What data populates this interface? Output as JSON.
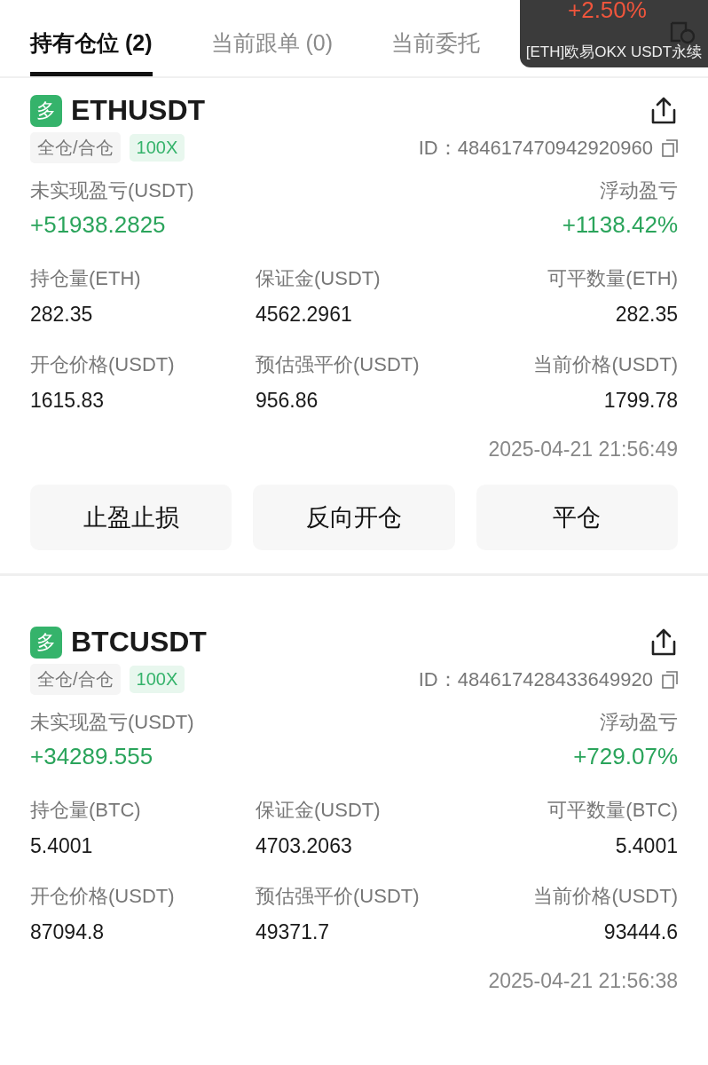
{
  "tabs": [
    {
      "label": "持有仓位 (2)",
      "selected": true
    },
    {
      "label": "当前跟单 (0)",
      "selected": false
    },
    {
      "label": "当前委托",
      "selected": false
    }
  ],
  "floating_widget": {
    "change": "+2.50%",
    "title": "[ETH]欧易OKX USDT永续"
  },
  "positions": [
    {
      "side": "多",
      "symbol": "ETHUSDT",
      "margin_mode": "全仓/合仓",
      "leverage": "100X",
      "id": "ID：484617470942920960",
      "pnl_label": "未实现盈亏(USDT)",
      "pnl": "+51938.2825",
      "ratio_label": "浮动盈亏",
      "ratio": "+1138.42%",
      "fields": [
        {
          "label": "持仓量(ETH)",
          "value": "282.35"
        },
        {
          "label": "保证金(USDT)",
          "value": "4562.2961"
        },
        {
          "label": "可平数量(ETH)",
          "value": "282.35"
        },
        {
          "label": "开仓价格(USDT)",
          "value": "1615.83"
        },
        {
          "label": "预估强平价(USDT)",
          "value": "956.86"
        },
        {
          "label": "当前价格(USDT)",
          "value": "1799.78"
        }
      ],
      "time": "2025-04-21 21:56:49",
      "actions": [
        "止盈止损",
        "反向开仓",
        "平仓"
      ]
    },
    {
      "side": "多",
      "symbol": "BTCUSDT",
      "margin_mode": "全仓/合仓",
      "leverage": "100X",
      "id": "ID：484617428433649920",
      "pnl_label": "未实现盈亏(USDT)",
      "pnl": "+34289.555",
      "ratio_label": "浮动盈亏",
      "ratio": "+729.07%",
      "fields": [
        {
          "label": "持仓量(BTC)",
          "value": "5.4001"
        },
        {
          "label": "保证金(USDT)",
          "value": "4703.2063"
        },
        {
          "label": "可平数量(BTC)",
          "value": "5.4001"
        },
        {
          "label": "开仓价格(USDT)",
          "value": "87094.8"
        },
        {
          "label": "预估强平价(USDT)",
          "value": "49371.7"
        },
        {
          "label": "当前价格(USDT)",
          "value": "93444.6"
        }
      ],
      "time": "2025-04-21 21:56:38"
    }
  ]
}
